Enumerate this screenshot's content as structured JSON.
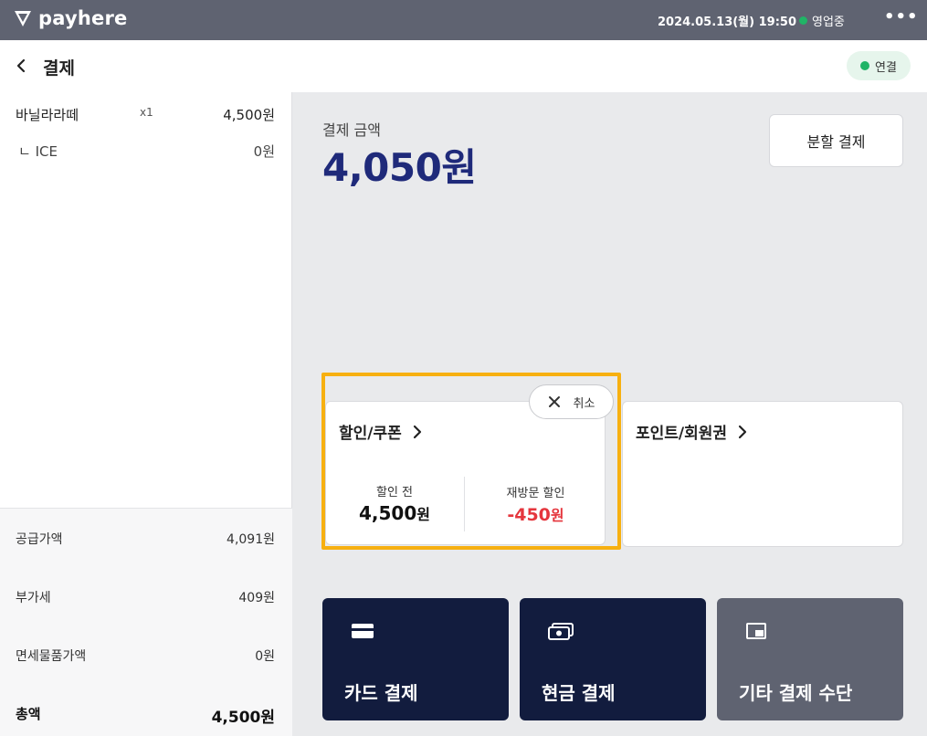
{
  "topbar": {
    "brand": "payhere",
    "datetime": "2024.05.13(월) 19:50",
    "status_label": "영업중",
    "status_color": "#20b466",
    "menu_icon": "more-horizontal-icon"
  },
  "header": {
    "title": "결제",
    "connection_label": "연결"
  },
  "order": {
    "items": [
      {
        "name": "바닐라라떼",
        "qty": "x1",
        "price": "4,500원"
      }
    ],
    "options": [
      {
        "name": "ㄴ ICE",
        "price": "0원"
      }
    ]
  },
  "summary": {
    "supply_label": "공급가액",
    "supply_value": "4,091원",
    "vat_label": "부가세",
    "vat_value": "409원",
    "taxfree_label": "면세물품가액",
    "taxfree_value": "0원",
    "total_label": "총액",
    "total_value": "4,500원"
  },
  "payment": {
    "amount_label": "결제 금액",
    "amount_value": "4,050원",
    "split_label": "분할 결제"
  },
  "discount": {
    "title": "할인/쿠폰",
    "cancel_label": "취소",
    "before_label": "할인 전",
    "before_amount": "4,500",
    "before_unit": "원",
    "applied_label": "재방문 할인",
    "applied_amount": "-450",
    "applied_unit": "원"
  },
  "points": {
    "title": "포인트/회원권"
  },
  "methods": {
    "card_label": "카드 결제",
    "cash_label": "현금 결제",
    "etc_label": "기타 결제 수단"
  },
  "colors": {
    "accent_navy": "#1f2a7a",
    "button_dark": "#121c3e",
    "highlight": "#f7b011",
    "discount_red": "#e5363d"
  }
}
